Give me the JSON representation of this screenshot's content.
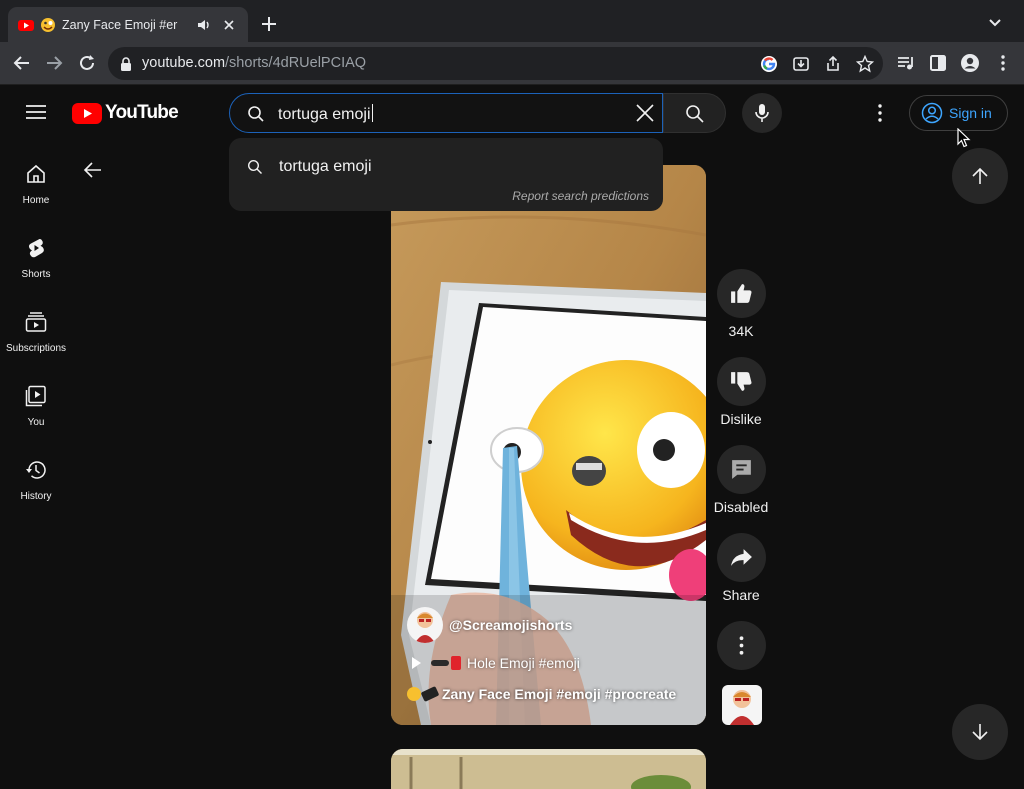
{
  "browser": {
    "tab_title": "Zany Face Emoji #er",
    "url_host": "youtube.com",
    "url_path": "/shorts/4dRUelPCIAQ"
  },
  "header": {
    "logo_text": "YouTube",
    "search_value": "tortuga emoji",
    "sign_in_label": "Sign in"
  },
  "suggestions": {
    "items": [
      "tortuga emoji"
    ],
    "report_label": "Report search predictions"
  },
  "sidebar": {
    "items": [
      {
        "label": "Home",
        "icon": "home-icon"
      },
      {
        "label": "Shorts",
        "icon": "shorts-icon"
      },
      {
        "label": "Subscriptions",
        "icon": "subscriptions-icon"
      },
      {
        "label": "You",
        "icon": "you-icon"
      },
      {
        "label": "History",
        "icon": "history-icon"
      }
    ]
  },
  "short": {
    "channel": "@Screamojishorts",
    "playlist": "Hole Emoji #emoji",
    "title": "Zany Face Emoji #emoji #procreate"
  },
  "actions": {
    "like_count": "34K",
    "dislike_label": "Dislike",
    "comments_label": "Disabled",
    "share_label": "Share"
  },
  "colors": {
    "background": "#0f0f0f",
    "accent_blue": "#3ea6ff",
    "youtube_red": "#ff0000"
  }
}
